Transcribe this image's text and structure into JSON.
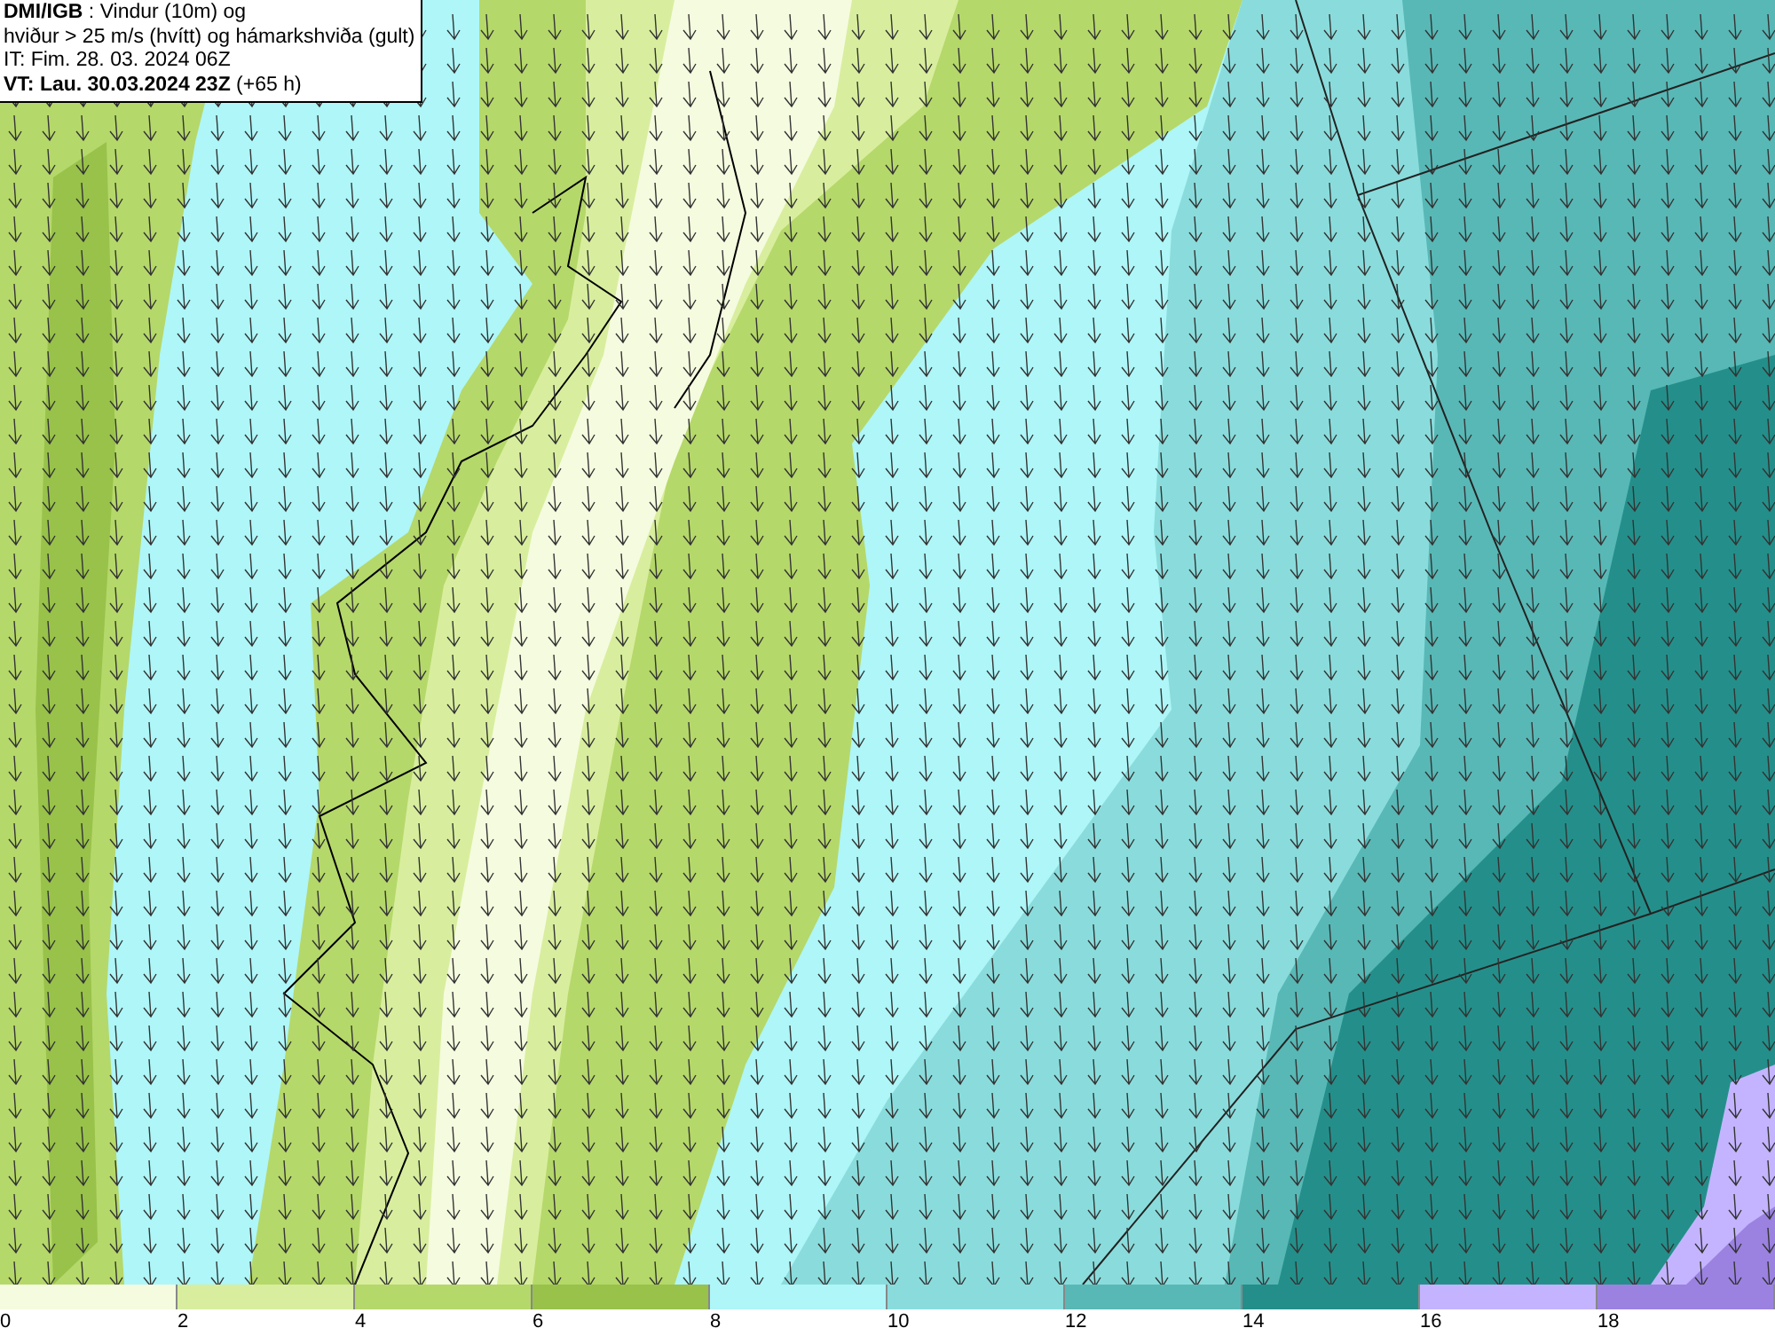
{
  "info_box": {
    "lines": [
      "**DMI/IGB** : Vindur (10m) og",
      "hviður > 25 m/s (hvítt) og hámarkshviða (gult)",
      "IT: Fim. 28. 03. 2024 06Z",
      "**VT: Lau. 30.03.2024 23Z** (+65 h)"
    ]
  },
  "legend": [
    {
      "label": "0",
      "color": "#f5fbdf"
    },
    {
      "label": "2",
      "color": "#d8ee9e"
    },
    {
      "label": "4",
      "color": "#b5d86a"
    },
    {
      "label": "6",
      "color": "#98c24a"
    },
    {
      "label": "8",
      "color": "#aef6f8"
    },
    {
      "label": "10",
      "color": "#8adcdc"
    },
    {
      "label": "12",
      "color": "#58b8b6"
    },
    {
      "label": "14",
      "color": "#248f8a"
    },
    {
      "label": "16",
      "color": "#c4b4ff"
    },
    {
      "label": "18",
      "color": "#9b82e0"
    }
  ]
}
